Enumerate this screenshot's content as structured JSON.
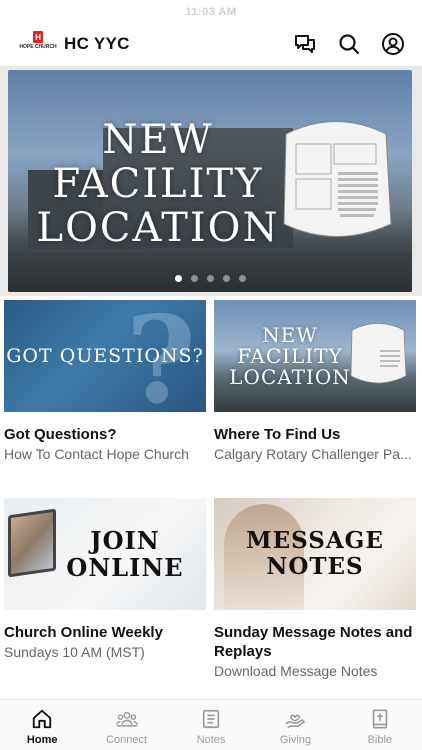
{
  "status_bar": {
    "time": "11:03 AM"
  },
  "header": {
    "logo_mark": "H",
    "logo_text": "HOPE CHURCH",
    "title": "HC YYC",
    "icons": [
      "chat-icon",
      "search-icon",
      "profile-icon"
    ]
  },
  "hero": {
    "title": "NEW FACILITY LOCATION",
    "slide_count": 5,
    "active_slide": 1
  },
  "cards": [
    {
      "image_text": "GOT QUESTIONS?",
      "title": "Got Questions?",
      "subtitle": "How To Contact Hope Church"
    },
    {
      "image_text": "NEW FACILITY LOCATION",
      "title": "Where To Find Us",
      "subtitle": "Calgary Rotary Challenger Pa..."
    },
    {
      "image_text": "JOIN ONLINE",
      "title": "Church Online Weekly",
      "subtitle": "Sundays 10 AM (MST)"
    },
    {
      "image_text": "MESSAGE NOTES",
      "title": "Sunday Message Notes and Replays",
      "subtitle": "Download Message Notes"
    }
  ],
  "tabbar": {
    "active": "Home",
    "items": [
      {
        "label": "Home",
        "icon": "home-icon"
      },
      {
        "label": "Connect",
        "icon": "people-icon"
      },
      {
        "label": "Notes",
        "icon": "notes-icon"
      },
      {
        "label": "Giving",
        "icon": "giving-icon"
      },
      {
        "label": "Bible",
        "icon": "bible-icon"
      }
    ]
  },
  "colors": {
    "brand_red": "#e2231a",
    "accent_text": "#111111",
    "muted_text": "#666666"
  }
}
